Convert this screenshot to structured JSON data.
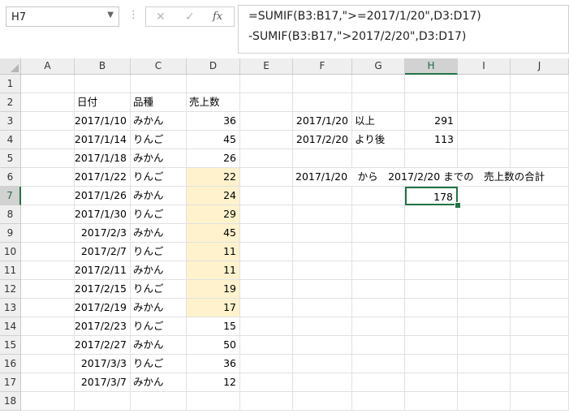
{
  "formula_bar": {
    "name_box": "H7",
    "formula_line1": "=SUMIF(B3:B17,\">=2017/1/20\",D3:D17)",
    "formula_line2": "-SUMIF(B3:B17,\">2017/2/20\",D3:D17)",
    "cancel_icon": "✕",
    "enter_icon": "✓",
    "fx_icon": "fx"
  },
  "columns": [
    "A",
    "B",
    "C",
    "D",
    "E",
    "F",
    "G",
    "H",
    "I",
    "J"
  ],
  "selected_column": "H",
  "rows": [
    "1",
    "2",
    "3",
    "4",
    "5",
    "6",
    "7",
    "8",
    "9",
    "10",
    "11",
    "12",
    "13",
    "14",
    "15",
    "16",
    "17",
    "18"
  ],
  "selected_row": "7",
  "table": {
    "headers": {
      "date": "日付",
      "variety": "品種",
      "sales": "売上数"
    },
    "records": [
      {
        "date": "2017/1/10",
        "variety": "みかん",
        "sales": "36"
      },
      {
        "date": "2017/1/14",
        "variety": "りんご",
        "sales": "45"
      },
      {
        "date": "2017/1/18",
        "variety": "みかん",
        "sales": "26"
      },
      {
        "date": "2017/1/22",
        "variety": "りんご",
        "sales": "22"
      },
      {
        "date": "2017/1/26",
        "variety": "みかん",
        "sales": "24"
      },
      {
        "date": "2017/1/30",
        "variety": "りんご",
        "sales": "29"
      },
      {
        "date": "2017/2/3",
        "variety": "みかん",
        "sales": "45"
      },
      {
        "date": "2017/2/7",
        "variety": "りんご",
        "sales": "11"
      },
      {
        "date": "2017/2/11",
        "variety": "みかん",
        "sales": "11"
      },
      {
        "date": "2017/2/15",
        "variety": "りんご",
        "sales": "19"
      },
      {
        "date": "2017/2/19",
        "variety": "みかん",
        "sales": "17"
      },
      {
        "date": "2017/2/23",
        "variety": "りんご",
        "sales": "15"
      },
      {
        "date": "2017/2/27",
        "variety": "みかん",
        "sales": "50"
      },
      {
        "date": "2017/3/3",
        "variety": "りんご",
        "sales": "36"
      },
      {
        "date": "2017/3/7",
        "variety": "みかん",
        "sales": "12"
      }
    ]
  },
  "side": {
    "f3": "2017/1/20",
    "g3": "以上",
    "h3": "291",
    "f4": "2017/2/20",
    "g4": "より後",
    "h4": "113",
    "row6_text": "2017/1/20　から　2017/2/20 までの　売上数の合計",
    "h7": "178"
  },
  "colors": {
    "highlight": "#fff2cc",
    "selection": "#217346"
  }
}
